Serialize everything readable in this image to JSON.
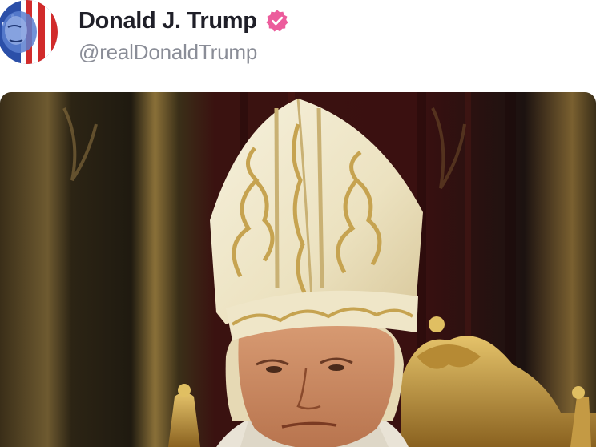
{
  "post": {
    "author_name": "Donald J. Trump",
    "handle": "@realDonaldTrump"
  },
  "icons": {
    "avatar": "avatar-image",
    "verified": "verified-badge-icon"
  },
  "colors": {
    "verified_badge": "#ec5c9c",
    "name_text": "#1f1f28",
    "handle_text": "#8a8d97"
  }
}
